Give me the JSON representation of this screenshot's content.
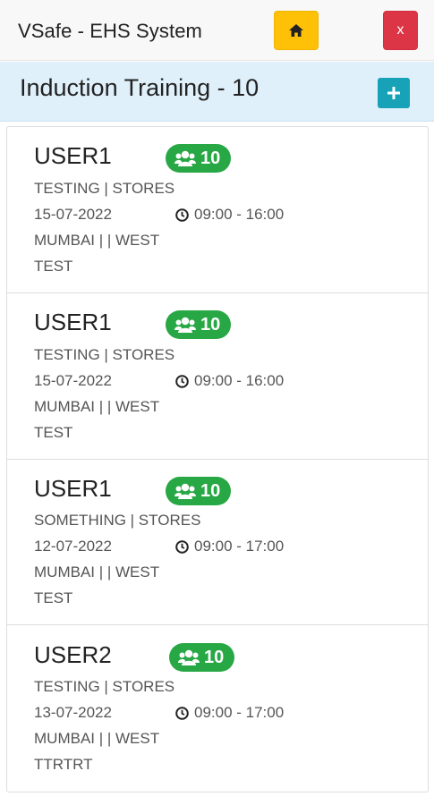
{
  "app": {
    "title": "VSafe - EHS System"
  },
  "toolbar": {
    "home_icon": "home-icon",
    "close_label": "x"
  },
  "page": {
    "title": "Induction Training - 10",
    "add_icon": "plus-icon"
  },
  "colors": {
    "home": "#ffc107",
    "close": "#dc3545",
    "add": "#17a2b8",
    "badge": "#28a745",
    "subheader_bg": "#dff0fb"
  },
  "trainings": [
    {
      "user": "USER1",
      "count": "10",
      "dept": "TESTING | STORES",
      "date": "15-07-2022",
      "time": "09:00 - 16:00",
      "location": "MUMBAI | | WEST",
      "note": "TEST"
    },
    {
      "user": "USER1",
      "count": "10",
      "dept": "TESTING | STORES",
      "date": "15-07-2022",
      "time": "09:00 - 16:00",
      "location": "MUMBAI | | WEST",
      "note": "TEST"
    },
    {
      "user": "USER1",
      "count": "10",
      "dept": "SOMETHING | STORES",
      "date": "12-07-2022",
      "time": "09:00 - 17:00",
      "location": "MUMBAI | | WEST",
      "note": "TEST"
    },
    {
      "user": "USER2",
      "count": "10",
      "dept": "TESTING | STORES",
      "date": "13-07-2022",
      "time": "09:00 - 17:00",
      "location": "MUMBAI | | WEST",
      "note": "TTRTRT"
    }
  ]
}
